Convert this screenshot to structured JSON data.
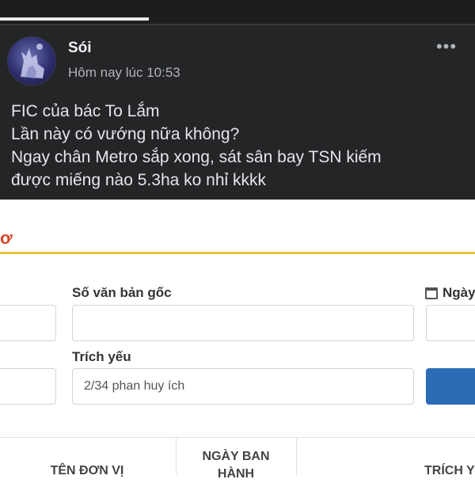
{
  "post": {
    "author": "Sói",
    "timestamp": "Hôm nay lúc 10:53",
    "more_label": "•••",
    "lines": [
      "FIC của bác To Lắm",
      "Lần này có vướng nữa không?",
      "Ngay chân Metro sắp xong, sát sân bay TSN kiếm",
      "được miếng nào 5.3ha ko nhỉ kkkk"
    ]
  },
  "form": {
    "header_stub": "ơ",
    "fields": {
      "so_van_ban_goc": {
        "label": "Số văn bản gốc",
        "value": ""
      },
      "ngay": {
        "label": "Ngày"
      },
      "trich_yeu": {
        "label": "Trích yếu",
        "value": "2/34 phan huy ích"
      }
    },
    "table_headers": {
      "ten_don_vi": "TÊN ĐƠN VỊ",
      "ngay_ban_hanh": [
        "NGÀY BAN",
        "HÀNH"
      ],
      "trich_yeu": "TRÍCH Y"
    }
  },
  "colors": {
    "post_bg": "#242526",
    "header_line": "#f0c240",
    "header_text": "#d9472b",
    "button": "#2a6db5"
  }
}
